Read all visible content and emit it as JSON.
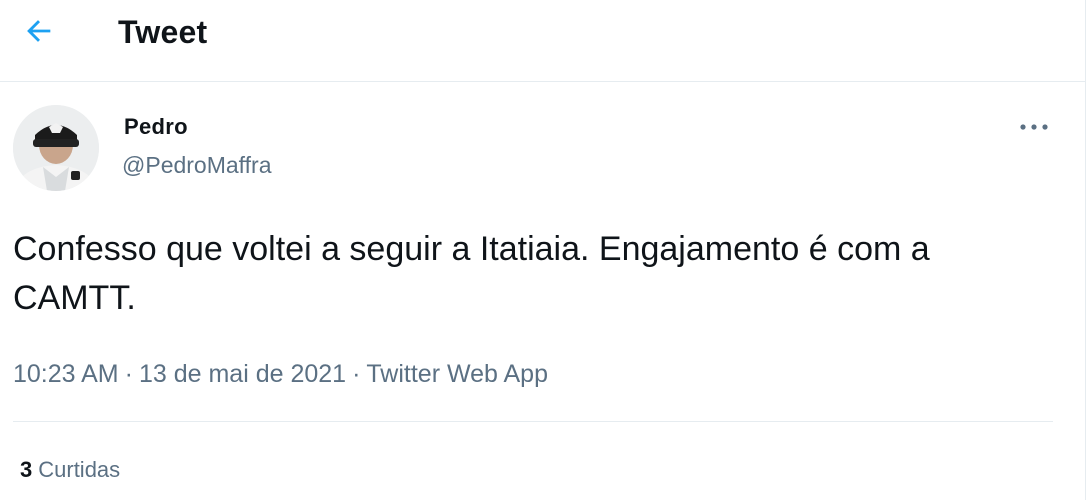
{
  "header": {
    "title": "Tweet",
    "back_icon": "arrow-left-icon"
  },
  "tweet": {
    "author_name": "Pedro",
    "author_handle": "@PedroMaffra",
    "text": "Confesso que voltei a seguir a Itatiaia. Engajamento é com a CAMTT.",
    "time": "10:23 AM",
    "separator": "·",
    "date": "13 de mai de 2021",
    "source": "Twitter Web App",
    "likes_count": "3",
    "likes_label": "Curtidas",
    "more_icon": "more-horizontal-icon"
  },
  "colors": {
    "accent": "#1da1f2",
    "text_primary": "#0f1419",
    "text_secondary": "#5b7083",
    "border": "#e6ecf0"
  }
}
